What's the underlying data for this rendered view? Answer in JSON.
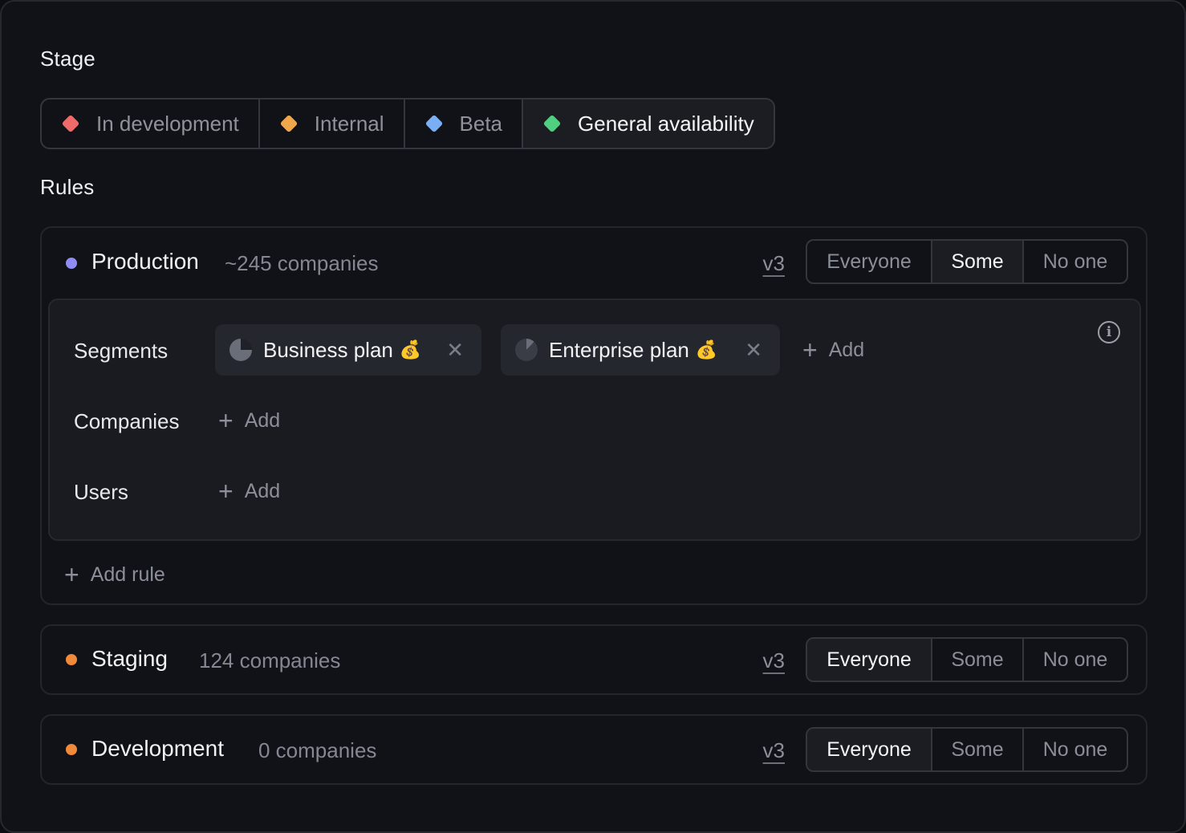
{
  "stage": {
    "title": "Stage",
    "options": [
      {
        "label": "In development",
        "color": "#f06a6a",
        "selected": false
      },
      {
        "label": "Internal",
        "color": "#f0a64a",
        "selected": false
      },
      {
        "label": "Beta",
        "color": "#7aaef5",
        "selected": false
      },
      {
        "label": "General availability",
        "color": "#4fcf7f",
        "selected": true
      }
    ]
  },
  "rules": {
    "title": "Rules",
    "environments": [
      {
        "name": "Production",
        "count": "~245 companies",
        "version": "v3",
        "dot_color": "#8f8cf5",
        "access": [
          "Everyone",
          "Some",
          "No one"
        ],
        "selected": "Some",
        "segments_label": "Segments",
        "segments": [
          {
            "label": "Business plan",
            "emoji": "💰",
            "close": "✕"
          },
          {
            "label": "Enterprise plan",
            "emoji": "💰",
            "close": "✕"
          }
        ],
        "companies_label": "Companies",
        "users_label": "Users",
        "add_label": "Add",
        "add_rule_label": "Add rule"
      },
      {
        "name": "Staging",
        "count": "124 companies",
        "version": "v3",
        "dot_color": "#f08a3a",
        "access": [
          "Everyone",
          "Some",
          "No one"
        ],
        "selected": "Everyone"
      },
      {
        "name": "Development",
        "count": "0 companies",
        "version": "v3",
        "dot_color": "#f08a3a",
        "access": [
          "Everyone",
          "Some",
          "No one"
        ],
        "selected": "Everyone"
      }
    ]
  },
  "icons": {
    "plus": "+",
    "info": "i",
    "close": "✕"
  }
}
